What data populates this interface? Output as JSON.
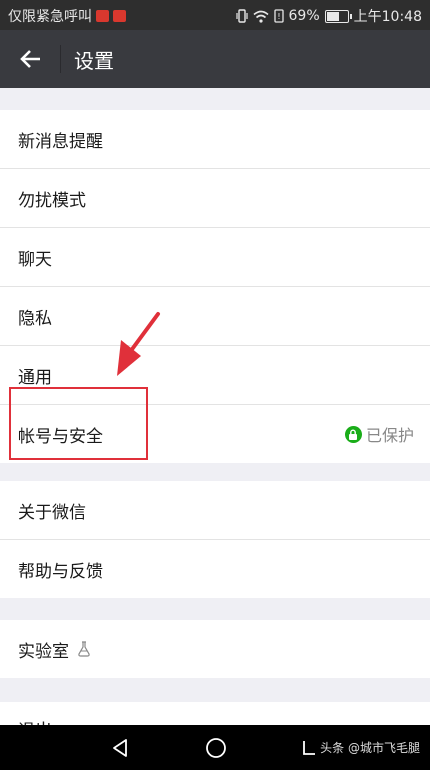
{
  "status_bar": {
    "carrier_text": "仅限紧急呼叫",
    "battery_percent": "69%",
    "battery_level": 0.69,
    "time": "上午10:48"
  },
  "header": {
    "back_icon": "arrow-left-icon",
    "title": "设置"
  },
  "groups": [
    {
      "items": [
        {
          "label": "新消息提醒"
        },
        {
          "label": "勿扰模式"
        },
        {
          "label": "聊天"
        },
        {
          "label": "隐私"
        },
        {
          "label": "通用"
        },
        {
          "label": "帐号与安全",
          "status": "已保护",
          "status_icon": "lock-icon"
        }
      ]
    },
    {
      "items": [
        {
          "label": "关于微信"
        },
        {
          "label": "帮助与反馈"
        }
      ]
    },
    {
      "items": [
        {
          "label": "实验室",
          "icon": "flask-icon"
        }
      ]
    },
    {
      "items": [
        {
          "label": "退出"
        }
      ]
    }
  ],
  "nav_bar": {
    "back_icon": "triangle-back-icon",
    "home_icon": "circle-home-icon",
    "recent_icon": "recent-apps-icon",
    "watermark": "头条 @城市飞毛腿"
  },
  "colors": {
    "status_bar": "#2e2e2e",
    "title_bar": "#393a3f",
    "background": "#efeff4",
    "accent_green": "#1aad19",
    "annotation_red": "#e0303a"
  }
}
